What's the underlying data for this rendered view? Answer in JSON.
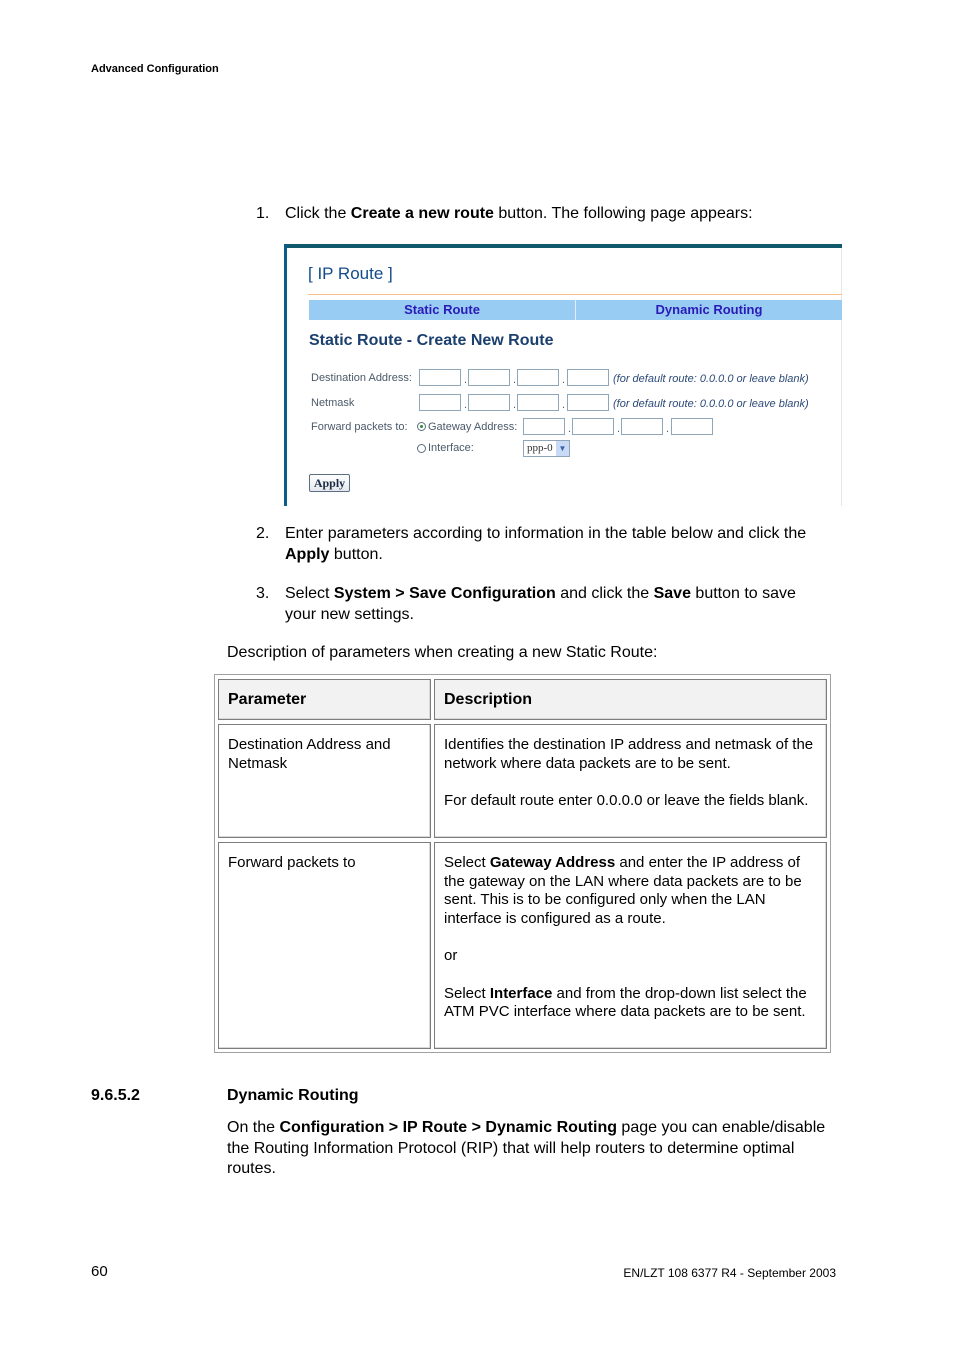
{
  "header": {
    "title": "Advanced Configuration"
  },
  "steps": [
    {
      "num": "1.",
      "parts": [
        "Click the ",
        "Create a new route",
        " button. The following page appears:"
      ]
    },
    {
      "num": "2.",
      "parts": [
        "Enter parameters according to information in the table below and click the ",
        "Apply",
        " button."
      ]
    },
    {
      "num": "3.",
      "parts": [
        "Select ",
        "System > Save Configuration",
        " and click the ",
        "Save",
        " button to save your new settings."
      ]
    }
  ],
  "screenshot": {
    "title": "[ IP Route ]",
    "tabs": [
      {
        "label": "Static Route"
      },
      {
        "label": "Dynamic Routing"
      }
    ],
    "subtitle": "Static Route - Create New Route",
    "destination_label": "Destination Address:",
    "netmask_label": "Netmask",
    "forward_label": "Forward packets to:",
    "gateway_label": "Gateway Address:",
    "interface_label": "Interface:",
    "hint": "(for default route: 0.0.0.0 or leave blank)",
    "dot": ".",
    "destination_octets": [
      "",
      "",
      "",
      ""
    ],
    "netmask_octets": [
      "",
      "",
      "",
      ""
    ],
    "gateway_octets": [
      "",
      "",
      "",
      ""
    ],
    "forward_selected": "Gateway Address",
    "interface_value": "ppp-0",
    "apply_label": "Apply",
    "colors": {
      "tab_bg": "#99ccf2",
      "tab_text": "#2a1bb8",
      "title": "#124b8a",
      "frame": "#115a6b"
    }
  },
  "description_intro": "Description of parameters when creating a new Static Route:",
  "table": {
    "headers": [
      "Parameter",
      "Description"
    ],
    "rows": [
      {
        "parameter": "Destination Address and Netmask",
        "description": [
          "Identifies the destination IP address and netmask of the network where data packets are to be sent.",
          "For default route enter 0.0.0.0 or leave the fields blank."
        ]
      },
      {
        "parameter": "Forward packets to",
        "description_parts": {
          "p1": [
            "Select ",
            "Gateway Address",
            " and enter the IP address of the gateway on the LAN where data packets are to be sent. This is to be configured only when the LAN interface is configured as a route."
          ],
          "p2": "or",
          "p3": [
            "Select ",
            "Interface",
            " and from the drop-down list select the ATM PVC interface where data packets are to be sent."
          ]
        }
      }
    ]
  },
  "section": {
    "number": "9.6.5.2",
    "title": "Dynamic Routing",
    "body_parts": [
      "On the ",
      "Configuration > IP Route > Dynamic Routing",
      " page you can enable/disable the Routing Information Protocol (RIP) that will help routers to determine optimal routes."
    ]
  },
  "footer": {
    "page": "60",
    "doc": "EN/LZT 108 6377 R4 - September 2003"
  }
}
